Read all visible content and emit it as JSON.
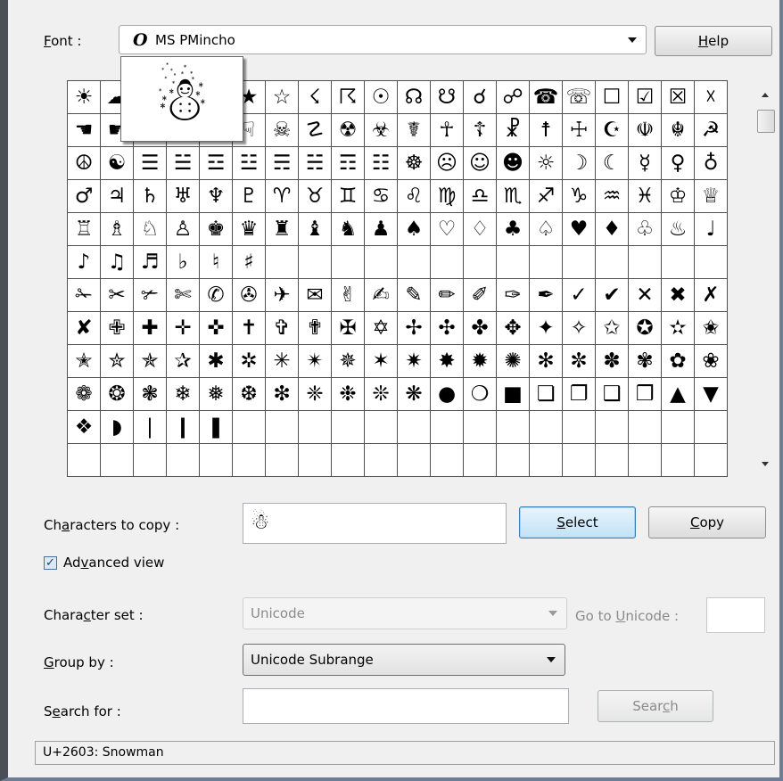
{
  "font": {
    "label_prefix": "",
    "label_key": "F",
    "label_rest": "ont :",
    "glyph": "O",
    "selected": "MS PMincho"
  },
  "help_button": {
    "key": "H",
    "rest": "elp"
  },
  "grid": {
    "rows": [
      [
        "☀",
        "☁",
        "☂",
        "☃",
        "☄",
        "★",
        "☆",
        "☇",
        "☈",
        "☉",
        "☊",
        "☋",
        "☌",
        "☍",
        "☎",
        "☏",
        "☐",
        "☑",
        "☒",
        "☓"
      ],
      [
        "☚",
        "☛",
        "☜",
        "☝",
        "☞",
        "☟",
        "☠",
        "☡",
        "☢",
        "☣",
        "☤",
        "☥",
        "☦",
        "☧",
        "☨",
        "☩",
        "☪",
        "☫",
        "☬",
        "☭"
      ],
      [
        "☮",
        "☯",
        "☰",
        "☱",
        "☲",
        "☳",
        "☴",
        "☵",
        "☶",
        "☷",
        "☸",
        "☹",
        "☺",
        "☻",
        "☼",
        "☽",
        "☾",
        "☿",
        "♀",
        "♁"
      ],
      [
        "♂",
        "♃",
        "♄",
        "♅",
        "♆",
        "♇",
        "♈",
        "♉",
        "♊",
        "♋",
        "♌",
        "♍",
        "♎",
        "♏",
        "♐",
        "♑",
        "♒",
        "♓",
        "♔",
        "♕"
      ],
      [
        "♖",
        "♗",
        "♘",
        "♙",
        "♚",
        "♛",
        "♜",
        "♝",
        "♞",
        "♟",
        "♠",
        "♡",
        "♢",
        "♣",
        "♤",
        "♥",
        "♦",
        "♧",
        "♨",
        "♩"
      ],
      [
        "♪",
        "♫",
        "♬",
        "♭",
        "♮",
        "♯",
        "",
        "",
        "",
        "",
        "",
        "",
        "",
        "",
        "",
        "",
        "",
        "",
        "",
        ""
      ],
      [
        "✁",
        "✂",
        "✃",
        "✄",
        "✆",
        "✇",
        "✈",
        "✉",
        "✌",
        "✍",
        "✎",
        "✏",
        "✐",
        "✑",
        "✒",
        "✓",
        "✔",
        "✕",
        "✖",
        "✗"
      ],
      [
        "✘",
        "✙",
        "✚",
        "✛",
        "✜",
        "✝",
        "✞",
        "✟",
        "✠",
        "✡",
        "✢",
        "✣",
        "✤",
        "✥",
        "✦",
        "✧",
        "✩",
        "✪",
        "✫",
        "✬"
      ],
      [
        "✭",
        "✮",
        "✯",
        "✰",
        "✱",
        "✲",
        "✳",
        "✴",
        "✵",
        "✶",
        "✷",
        "✸",
        "✹",
        "✺",
        "✻",
        "✼",
        "✽",
        "✾",
        "✿",
        "❀"
      ],
      [
        "❁",
        "❂",
        "❃",
        "❄",
        "❅",
        "❆",
        "❇",
        "❈",
        "❉",
        "❊",
        "❋",
        "●",
        "❍",
        "■",
        "❏",
        "❐",
        "❑",
        "❒",
        "▲",
        "▼"
      ],
      [
        "❖",
        "◗",
        "❘",
        "❙",
        "❚",
        "",
        "",
        "",
        "",
        "",
        "",
        "",
        "",
        "",
        "",
        "",
        "",
        "",
        "",
        ""
      ],
      [
        "",
        "",
        "",
        "",
        "",
        "",
        "",
        "",
        "",
        "",
        "",
        "",
        "",
        "",
        "",
        "",
        "",
        "",
        "",
        ""
      ]
    ]
  },
  "preview_glyph": "☃",
  "copy_row": {
    "label_prefix": "Ch",
    "label_key": "a",
    "label_rest": "racters to copy :",
    "value": "☃",
    "select_key": "S",
    "select_rest": "elect",
    "copy_key": "C",
    "copy_rest": "opy"
  },
  "advanced": {
    "checked": "✓",
    "prefix": "Ad",
    "key": "v",
    "rest": "anced view"
  },
  "charset": {
    "prefix": "Chara",
    "key": "c",
    "rest": "ter set :",
    "value": "Unicode",
    "goto_prefix": "Go to ",
    "goto_key": "U",
    "goto_rest": "nicode :"
  },
  "groupby": {
    "key": "G",
    "rest": "roup by :",
    "value": "Unicode Subrange"
  },
  "search": {
    "prefix": "S",
    "key": "e",
    "rest": "arch for :",
    "button_prefix": "Sear",
    "button_key": "c",
    "button_rest": "h"
  },
  "status": "U+2603: Snowman"
}
